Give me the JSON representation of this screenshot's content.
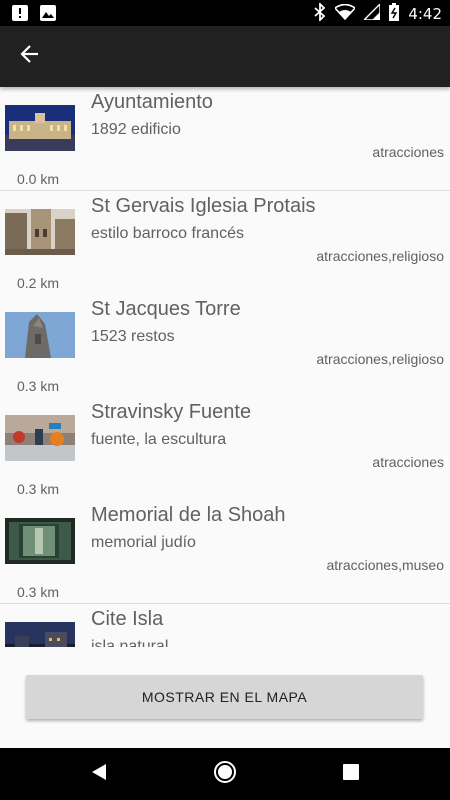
{
  "status_bar": {
    "time": "4:42",
    "icons": [
      "warning-badge-icon",
      "image-icon",
      "bluetooth-icon",
      "wifi-icon",
      "signal-icon",
      "battery-icon"
    ]
  },
  "app_bar": {
    "back_icon": "arrow-back-icon"
  },
  "places": [
    {
      "title": "Ayuntamiento",
      "subtitle": "1892 edificio",
      "category": "atracciones",
      "distance": "0.0 km"
    },
    {
      "title": "St Gervais Iglesia Protais",
      "subtitle": "estilo barroco francés",
      "category": "atracciones,religioso",
      "distance": "0.2 km"
    },
    {
      "title": "St Jacques Torre",
      "subtitle": "1523 restos",
      "category": "atracciones,religioso",
      "distance": "0.3 km"
    },
    {
      "title": "Stravinsky Fuente",
      "subtitle": "fuente, la escultura",
      "category": "atracciones",
      "distance": "0.3 km"
    },
    {
      "title": "Memorial de la Shoah",
      "subtitle": "memorial judío",
      "category": "atracciones,museo",
      "distance": "0.3 km"
    },
    {
      "title": "Cite Isla",
      "subtitle": "isla natural",
      "category": "",
      "distance": ""
    }
  ],
  "map_button": {
    "label": "MOSTRAR EN EL MAPA"
  },
  "nav_bar": {
    "icons": [
      "back-triangle-icon",
      "home-circle-icon",
      "recents-square-icon"
    ]
  },
  "colors": {
    "app_bar": "#212121",
    "background": "#fafafa",
    "button": "#d6d6d6",
    "text": "#616161"
  }
}
